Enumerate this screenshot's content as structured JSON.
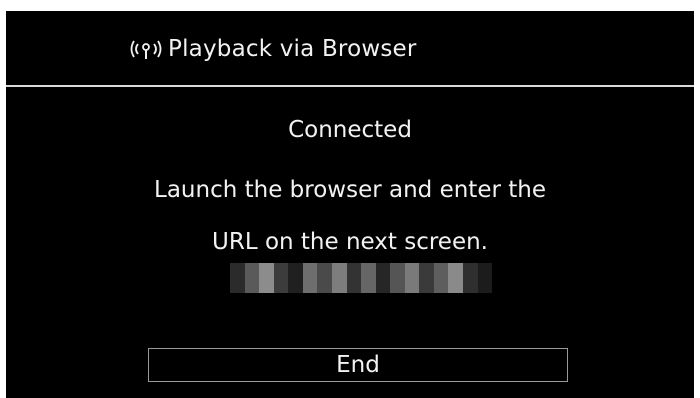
{
  "header": {
    "icon": "wireless-icon",
    "title": "Playback via Browser"
  },
  "body": {
    "status": "Connected",
    "message_line1": "Launch the browser and enter the",
    "message_line2": "URL on the next screen.",
    "url_redacted": true
  },
  "actions": {
    "end_label": "End"
  },
  "colors": {
    "background": "#000000",
    "text": "#f2f2f2",
    "divider": "#d9d9d9",
    "button_border": "#9a9a9a"
  }
}
